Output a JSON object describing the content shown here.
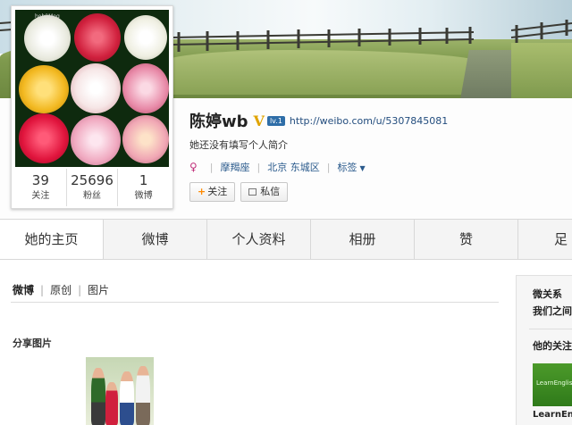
{
  "avatar": {
    "watermark": "hoh0Mog"
  },
  "stats": [
    {
      "value": "39",
      "label": "关注"
    },
    {
      "value": "25696",
      "label": "粉丝"
    },
    {
      "value": "1",
      "label": "微博"
    }
  ],
  "profile": {
    "name": "陈婷wb",
    "verified_badge": "V",
    "level_badge": "lv.1",
    "url": "http://weibo.com/u/5307845081",
    "bio": "她还没有填写个人简介",
    "gender_icon": "female-icon",
    "zodiac": "摩羯座",
    "location": "北京 东城区",
    "tags_label": "标签"
  },
  "actions": {
    "follow": "关注",
    "message": "私信"
  },
  "tabs": [
    "她的主页",
    "微博",
    "个人资料",
    "相册",
    "赞",
    "足"
  ],
  "feed": {
    "tabs": [
      "微博",
      "原创",
      "图片"
    ],
    "share_title": "分享图片"
  },
  "side": {
    "title": "微关系",
    "subtitle": "我们之间",
    "follow_title": "他的关注",
    "ad_text": "LearnEnglish",
    "ad_caption": "LearnEn"
  },
  "colors": {
    "link": "#234d7e",
    "accent": "#ff8a00",
    "verified": "#e0a400"
  }
}
